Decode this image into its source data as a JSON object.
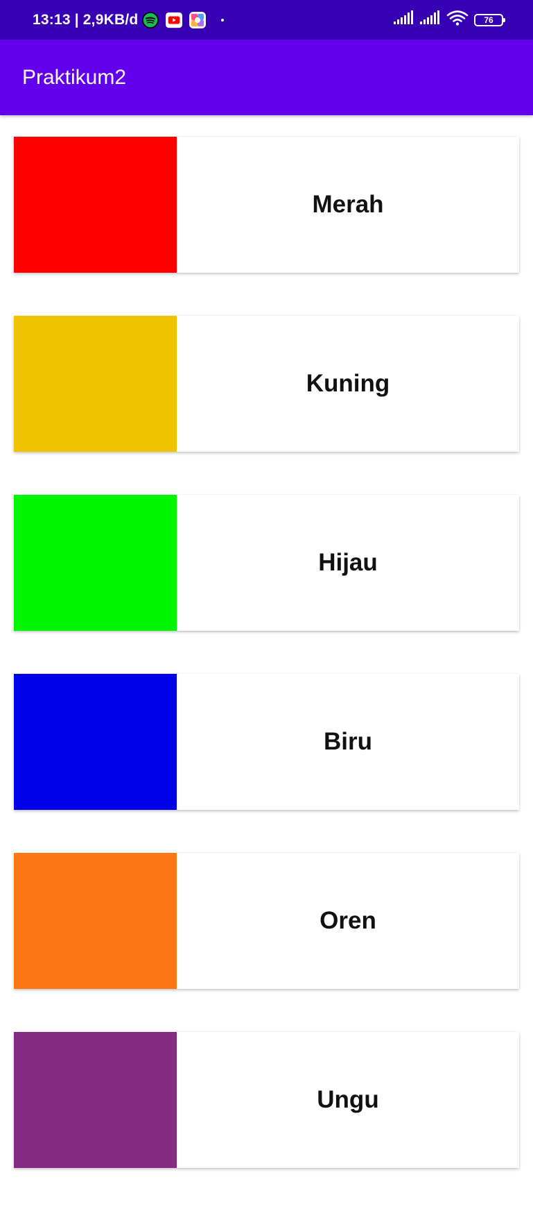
{
  "status_bar": {
    "time": "13:13",
    "separator": "|",
    "data_rate": "2,9KB/d",
    "battery": "76",
    "icons": [
      "spotify-icon",
      "youtube-icon",
      "app-icon",
      "signal-icon",
      "signal-icon",
      "wifi-icon",
      "battery-icon"
    ],
    "colors": {
      "background": "#3700b3"
    }
  },
  "app_bar": {
    "title": "Praktikum2",
    "color": "#6200ee"
  },
  "items": [
    {
      "label": "Merah",
      "color": "#ff0000"
    },
    {
      "label": "Kuning",
      "color": "#efc300"
    },
    {
      "label": "Hijau",
      "color": "#00f500"
    },
    {
      "label": "Biru",
      "color": "#0000e8"
    },
    {
      "label": "Oren",
      "color": "#fc7614"
    },
    {
      "label": "Ungu",
      "color": "#852a82"
    }
  ]
}
